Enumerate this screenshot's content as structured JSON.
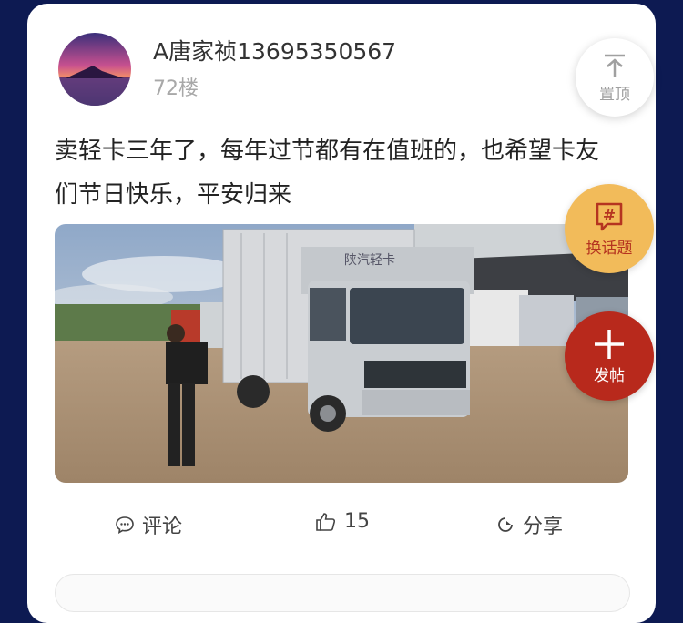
{
  "post": {
    "username": "A唐家祯13695350567",
    "floor": "72楼",
    "text": "卖轻卡三年了，每年过节都有在值班的，也希望卡友们节日快乐，平安归来",
    "image_icon": "truck-photo",
    "truck_door_text": "陕汽轻卡"
  },
  "actions": {
    "comment_label": "评论",
    "like_count": "15",
    "share_label": "分享"
  },
  "floating": {
    "top_label": "置顶",
    "topic_label": "换话题",
    "post_label": "发帖"
  },
  "colors": {
    "background": "#0d1a52",
    "topic_button": "#f2bb5a",
    "post_button": "#b8291c"
  }
}
